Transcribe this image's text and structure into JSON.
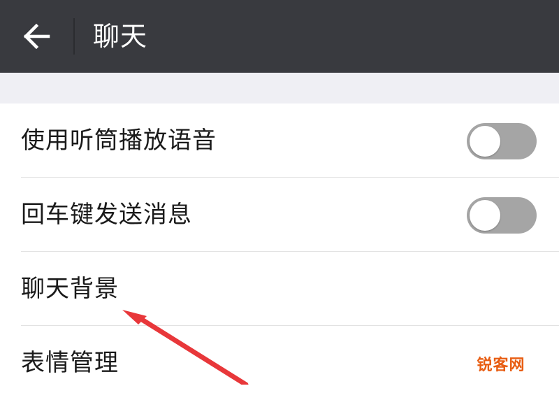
{
  "header": {
    "title": "聊天",
    "back_icon": "arrow-left-icon"
  },
  "settings": {
    "items": [
      {
        "label": "使用听筒播放语音",
        "toggle": false
      },
      {
        "label": "回车键发送消息",
        "toggle": false
      },
      {
        "label": "聊天背景"
      },
      {
        "label": "表情管理"
      }
    ]
  },
  "watermark": {
    "text": "锐客网"
  },
  "colors": {
    "header_bg": "#393a3f",
    "section_gap_bg": "#efeff4",
    "toggle_off": "#a5a5a5",
    "annotation_arrow": "#e8373a",
    "watermark_text": "#e85d12"
  }
}
